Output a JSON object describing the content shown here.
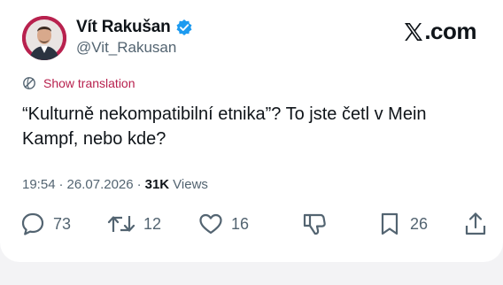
{
  "author": {
    "display_name": "Vít Rakušan",
    "handle": "@Vit_Rakusan",
    "verified": true,
    "avatar": "avatar-photo"
  },
  "brand": {
    "label": ".com",
    "logo": "x-logo-icon"
  },
  "translate": {
    "label": "Show translation",
    "icon": "globe-icon",
    "color": "#b8214e"
  },
  "tweet": {
    "text": "“Kulturně nekompatibilní etnika”? To jste četl v Mein Kampf, nebo kde?",
    "time": "19:54",
    "separator": "·",
    "date": "26.07.2026",
    "separator2": "·",
    "views_count": "31K",
    "views_label": "Views"
  },
  "actions": {
    "reply": {
      "icon": "reply-icon",
      "count": "73"
    },
    "repost": {
      "icon": "repost-icon",
      "count": "12"
    },
    "like": {
      "icon": "heart-icon",
      "count": "16"
    },
    "dislike": {
      "icon": "thumbs-down-icon"
    },
    "bookmark": {
      "icon": "bookmark-icon",
      "count": "26"
    },
    "share": {
      "icon": "share-icon"
    }
  },
  "colors": {
    "accent": "#b8214e",
    "text": "#0f1419",
    "muted": "#536471",
    "verified": "#1d9bf0"
  }
}
